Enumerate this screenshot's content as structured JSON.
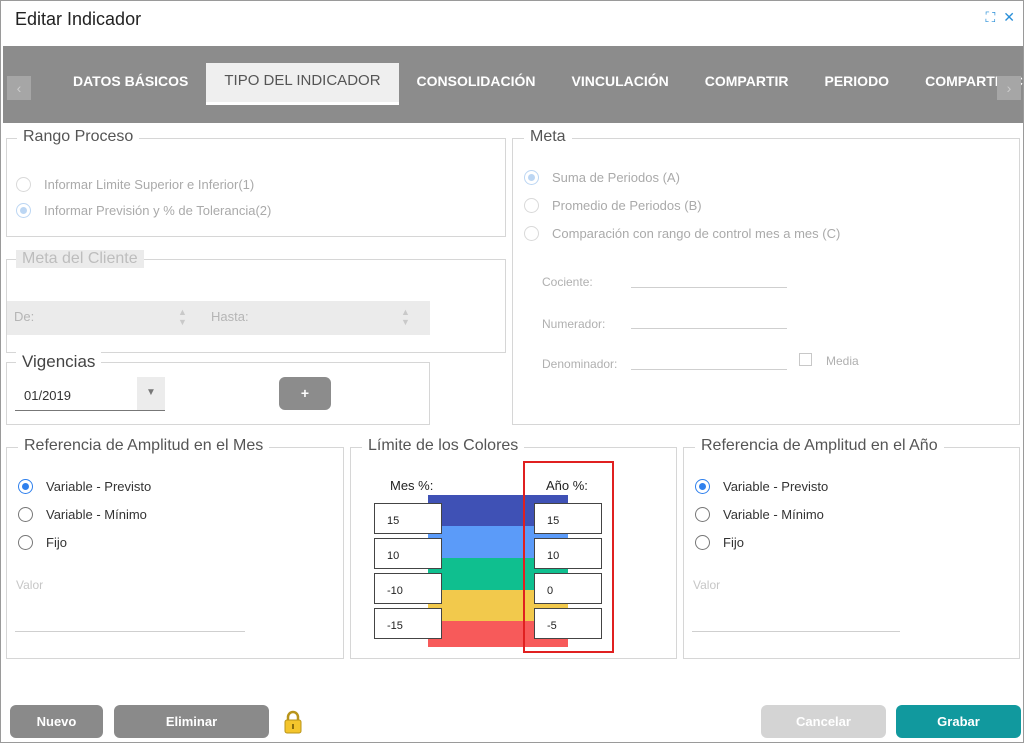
{
  "window": {
    "title": "Editar Indicador",
    "expand_icon": "expand-icon",
    "close_icon": "close-icon",
    "expand_glyph": "⛶",
    "close_glyph": "✕"
  },
  "tabs": {
    "arrow_left": "‹",
    "arrow_right": "›",
    "items": [
      {
        "label": "DATOS BÁSICOS"
      },
      {
        "label": "TIPO DEL INDICADOR"
      },
      {
        "label": "CONSOLIDACIÓN"
      },
      {
        "label": "VINCULACIÓN"
      },
      {
        "label": "COMPARTIR"
      },
      {
        "label": "PERIODO"
      },
      {
        "label": "COMPARTIR CC"
      }
    ],
    "active": "TIPO DEL INDICADOR"
  },
  "rango_proceso": {
    "title": "Rango Proceso",
    "options": [
      {
        "label": "Informar Limite Superior e Inferior(1)",
        "selected": false
      },
      {
        "label": "Informar Previsión y % de Tolerancia(2)",
        "selected": true
      }
    ]
  },
  "meta": {
    "title": "Meta",
    "options": [
      {
        "label": "Suma de Periodos (A)",
        "selected": true
      },
      {
        "label": "Promedio de Periodos (B)",
        "selected": false
      },
      {
        "label": "Comparación con rango de control mes a mes (C)",
        "selected": false
      }
    ],
    "cociente_label": "Cociente:",
    "numerador_label": "Numerador:",
    "denominador_label": "Denominador:",
    "media_label": "Media"
  },
  "meta_cliente": {
    "title": "Meta del Cliente",
    "de_label": "De:",
    "hasta_label": "Hasta:"
  },
  "vigencias": {
    "title": "Vigencias",
    "value": "01/2019",
    "add_label": "+"
  },
  "amplitud_mes": {
    "title": "Referencia de Amplitud en el Mes",
    "options": [
      {
        "label": "Variable - Previsto",
        "selected": true
      },
      {
        "label": "Variable - Mínimo",
        "selected": false
      },
      {
        "label": "Fijo",
        "selected": false
      }
    ],
    "valor_label": "Valor"
  },
  "limite_colores": {
    "title": "Límite de los Colores",
    "mes_label": "Mes %:",
    "anio_label": "Año %:",
    "mes_values": [
      "15",
      "10",
      "-10",
      "-15"
    ],
    "anio_values": [
      "15",
      "10",
      "0",
      "-5"
    ],
    "colors": [
      "#3f51b5",
      "#5b9bf9",
      "#0fbf8f",
      "#f2c94c",
      "#f75a5a"
    ],
    "highlight_color": "#e02020"
  },
  "amplitud_anio": {
    "title": "Referencia de Amplitud en el Año",
    "options": [
      {
        "label": "Variable - Previsto",
        "selected": true
      },
      {
        "label": "Variable - Mínimo",
        "selected": false
      },
      {
        "label": "Fijo",
        "selected": false
      }
    ],
    "valor_label": "Valor"
  },
  "footer": {
    "nuevo_label": "Nuevo",
    "eliminar_label": "Eliminar",
    "cancelar_label": "Cancelar",
    "grabar_label": "Grabar",
    "lock_icon": "lock-icon",
    "button_gray": "#8a8a8a",
    "button_disabled": "#d4d4d4",
    "button_primary": "#11999e"
  }
}
